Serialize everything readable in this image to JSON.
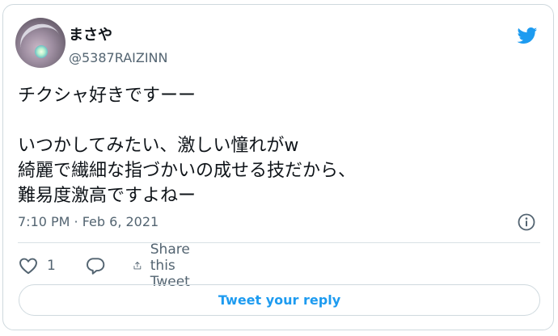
{
  "user": {
    "display_name": "まさや",
    "handle": "@5387RAIZINN"
  },
  "tweet": {
    "text": "チクシャ好きですーー\n\nいつかしてみたい、激しい憧れがw\n綺麗で繊細な指づかいの成せる技だから、\n難易度激高ですよねー",
    "timestamp": "7:10 PM · Feb 6, 2021"
  },
  "actions": {
    "like_count": "1",
    "share_label": "Share this Tweet"
  },
  "reply_button_label": "Tweet your reply",
  "icons": {
    "brand": "twitter-bird-icon",
    "info": "info-icon",
    "like": "heart-icon",
    "reply": "reply-bubble-icon",
    "share": "share-icon"
  },
  "colors": {
    "brand": "#1d9bf0",
    "text": "#0f1419",
    "secondary": "#536471",
    "border": "#cfd9de"
  }
}
